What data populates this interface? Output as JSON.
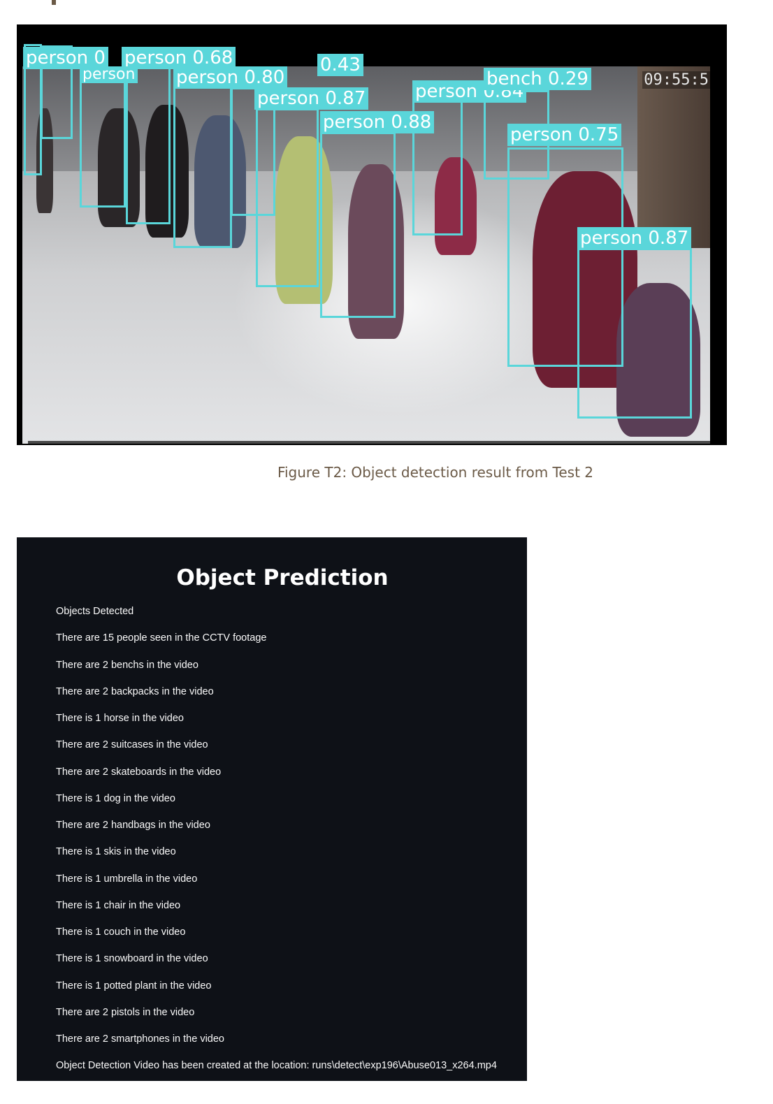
{
  "figure": {
    "caption": "Figure T2: Object detection result from Test 2",
    "timestamp": "09:55:5",
    "detection_color": "#5ad6da",
    "detections": [
      {
        "label": "person 0"
      },
      {
        "label": "person 0.68"
      },
      {
        "label": "person"
      },
      {
        "label": "person 0.80"
      },
      {
        "label": "0.43"
      },
      {
        "label": "person 0.87"
      },
      {
        "label": "person 0.84"
      },
      {
        "label": "bench 0.29"
      },
      {
        "label": "person 0.88"
      },
      {
        "label": "person 0.75"
      },
      {
        "label": "person 0.87"
      }
    ]
  },
  "panel": {
    "title": "Object Prediction",
    "background": "#0e1117",
    "lines": [
      "Objects Detected",
      "There are 15 people seen in the CCTV footage",
      "There are 2 benchs in the video",
      "There are 2 backpacks in the video",
      "There is 1 horse in the video",
      "There are 2 suitcases in the video",
      "There are 2 skateboards in the video",
      "There is 1 dog in the video",
      "There are 2 handbags in the video",
      "There is 1 skis in the video",
      "There is 1 umbrella in the video",
      "There is 1 chair in the video",
      "There is 1 couch in the video",
      "There is 1 snowboard in the video",
      "There is 1 potted plant in the video",
      "There are 2 pistols in the video",
      "There are 2 smartphones in the video",
      "Object Detection Video has been created at the location: runs\\detect\\exp196\\Abuse013_x264.mp4"
    ]
  }
}
